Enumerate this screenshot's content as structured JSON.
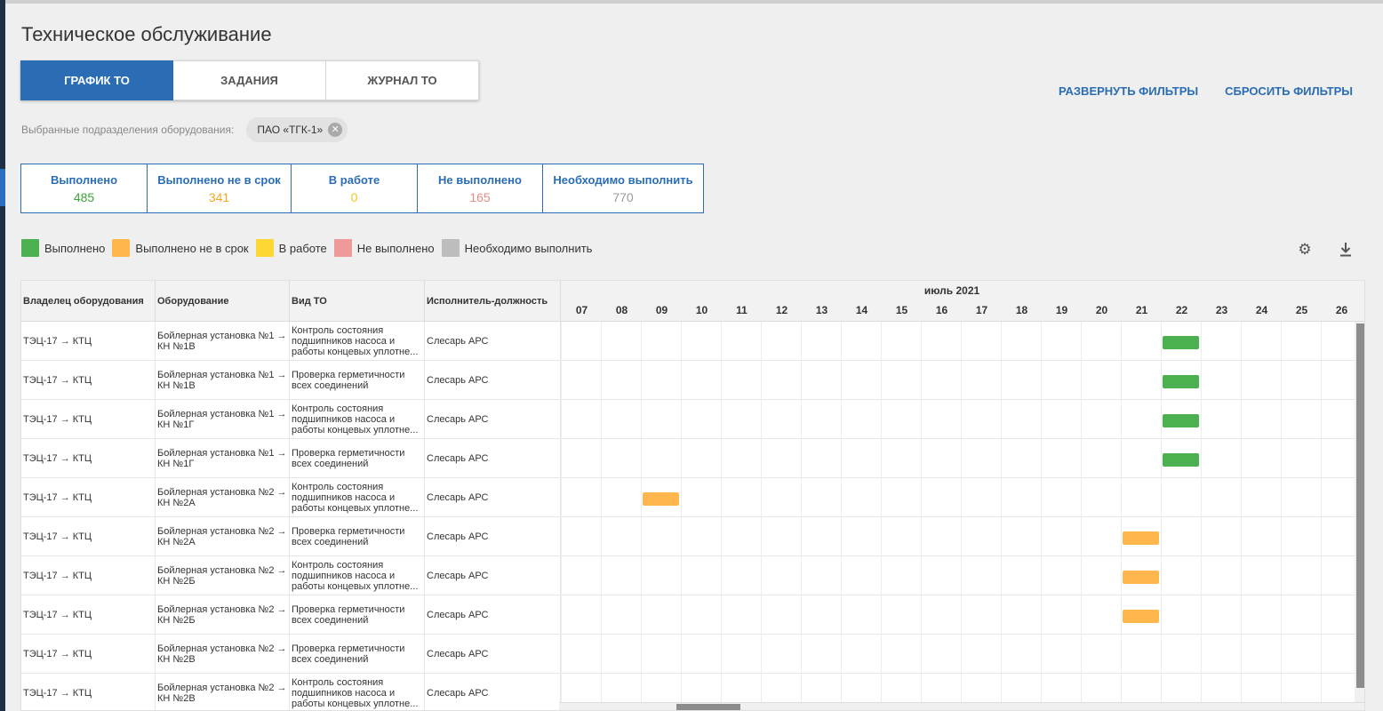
{
  "page": {
    "title": "Техническое обслуживание"
  },
  "tabs": [
    {
      "label": "ГРАФИК ТО",
      "active": true
    },
    {
      "label": "ЗАДАНИЯ",
      "active": false
    },
    {
      "label": "ЖУРНАЛ ТО",
      "active": false
    }
  ],
  "filters": {
    "expand_label": "РАЗВЕРНУТЬ ФИЛЬТРЫ",
    "reset_label": "СБРОСИТЬ ФИЛЬТРЫ",
    "subdivisions_label": "Выбранные подразделения оборудования:",
    "chip_label": "ПАО «ТГК-1»"
  },
  "stats": [
    {
      "label": "Выполнено",
      "value": "485",
      "color": "#3aa53a"
    },
    {
      "label": "Выполнено не в срок",
      "value": "341",
      "color": "#f5a623"
    },
    {
      "label": "В работе",
      "value": "0",
      "color": "#f3c61f"
    },
    {
      "label": "Не выполнено",
      "value": "165",
      "color": "#e88a8a"
    },
    {
      "label": "Необходимо выполнить",
      "value": "770",
      "color": "#9a9a9a"
    }
  ],
  "legend": [
    {
      "label": "Выполнено",
      "color": "#4caf50"
    },
    {
      "label": "Выполнено не в срок",
      "color": "#ffb74d"
    },
    {
      "label": "В работе",
      "color": "#fdd835"
    },
    {
      "label": "Не выполнено",
      "color": "#ef9a9a"
    },
    {
      "label": "Необходимо выполнить",
      "color": "#bdbdbd"
    }
  ],
  "icons": {
    "settings": "gear-icon",
    "download": "download-icon"
  },
  "table": {
    "columns": [
      "Владелец оборудования",
      "Оборудование",
      "Вид ТО",
      "Исполнитель-должность"
    ],
    "month": "июль 2021",
    "days": [
      "07",
      "08",
      "09",
      "10",
      "11",
      "12",
      "13",
      "14",
      "15",
      "16",
      "17",
      "18",
      "19",
      "20",
      "21",
      "22",
      "23",
      "24",
      "25",
      "26"
    ],
    "rows": [
      {
        "owner": "ТЭЦ-17 → КТЦ",
        "equipment": "Бойлерная установка №1 → КН №1В",
        "type": "Контроль состояния подшипников насоса и работы концевых уплотне...",
        "executor": "Слесарь АРС",
        "day": "22",
        "status": "done"
      },
      {
        "owner": "ТЭЦ-17 → КТЦ",
        "equipment": "Бойлерная установка №1 → КН №1В",
        "type": "Проверка герметичности всех соединений",
        "executor": "Слесарь АРС",
        "day": "22",
        "status": "done"
      },
      {
        "owner": "ТЭЦ-17 → КТЦ",
        "equipment": "Бойлерная установка №1 → КН №1Г",
        "type": "Контроль состояния подшипников насоса и работы концевых уплотне...",
        "executor": "Слесарь АРС",
        "day": "22",
        "status": "done"
      },
      {
        "owner": "ТЭЦ-17 → КТЦ",
        "equipment": "Бойлерная установка №1 → КН №1Г",
        "type": "Проверка герметичности всех соединений",
        "executor": "Слесарь АРС",
        "day": "22",
        "status": "done"
      },
      {
        "owner": "ТЭЦ-17 → КТЦ",
        "equipment": "Бойлерная установка №2 → КН №2А",
        "type": "Контроль состояния подшипников насоса и работы концевых уплотне...",
        "executor": "Слесарь АРС",
        "day": "09",
        "status": "late"
      },
      {
        "owner": "ТЭЦ-17 → КТЦ",
        "equipment": "Бойлерная установка №2 → КН №2А",
        "type": "Проверка герметичности всех соединений",
        "executor": "Слесарь АРС",
        "day": "21",
        "status": "late"
      },
      {
        "owner": "ТЭЦ-17 → КТЦ",
        "equipment": "Бойлерная установка №2 → КН №2Б",
        "type": "Контроль состояния подшипников насоса и работы концевых уплотне...",
        "executor": "Слесарь АРС",
        "day": "21",
        "status": "late"
      },
      {
        "owner": "ТЭЦ-17 → КТЦ",
        "equipment": "Бойлерная установка №2 → КН №2Б",
        "type": "Проверка герметичности всех соединений",
        "executor": "Слесарь АРС",
        "day": "21",
        "status": "late"
      },
      {
        "owner": "ТЭЦ-17 → КТЦ",
        "equipment": "Бойлерная установка №2 → КН №2В",
        "type": "Проверка герметичности всех соединений",
        "executor": "Слесарь АРС",
        "day": "",
        "status": ""
      },
      {
        "owner": "ТЭЦ-17 → КТЦ",
        "equipment": "Бойлерная установка №2 → КН №2В",
        "type": "Контроль состояния подшипников насоса и работы концевых уплотне...",
        "executor": "Слесарь АРС",
        "day": "",
        "status": ""
      }
    ]
  },
  "colors": {
    "accent": "#2a6db5",
    "done": "#4caf50",
    "late": "#ffb74d"
  }
}
